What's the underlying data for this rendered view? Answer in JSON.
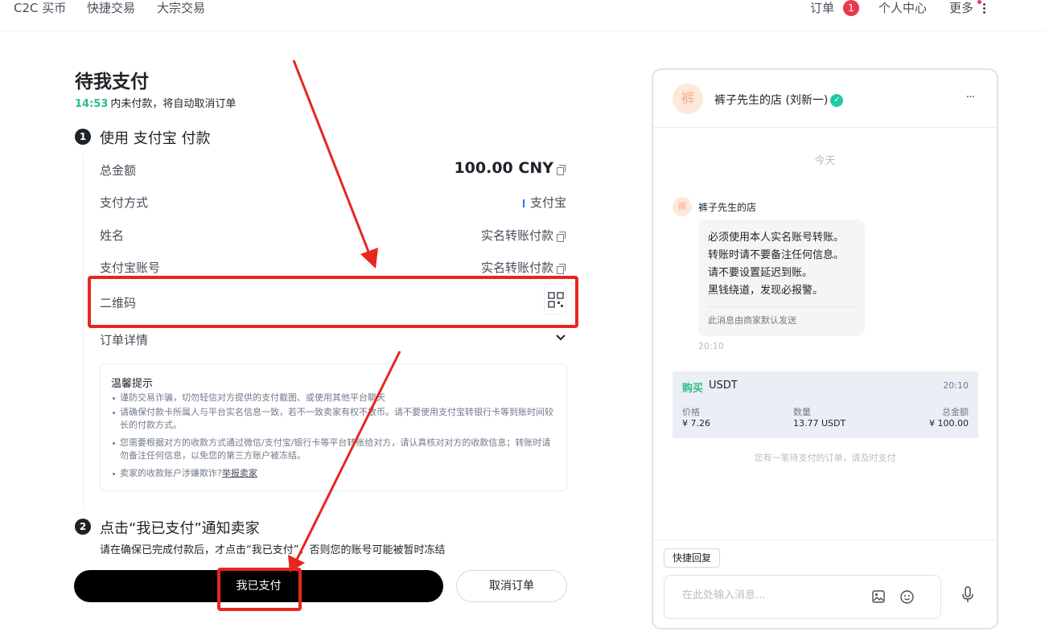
{
  "nav": {
    "c2c_buy": "C2C 买币",
    "quick_trade": "快捷交易",
    "bulk_trade": "大宗交易",
    "orders": "订单",
    "orders_badge": "1",
    "profile": "个人中心",
    "more": "更多"
  },
  "page": {
    "title": "待我支付",
    "countdown_time": "14:53",
    "countdown_text": "内未付款，将自动取消订单"
  },
  "step1": {
    "number": "1",
    "title": "使用 支付宝 付款",
    "rows": [
      {
        "label": "总金额",
        "value": "100.00 CNY"
      },
      {
        "label": "支付方式",
        "value": "支付宝"
      },
      {
        "label": "姓名",
        "value": "实名转账付款"
      },
      {
        "label": "支付宝账号",
        "value": "实名转账付款"
      },
      {
        "label": "二维码"
      },
      {
        "label": "订单详情"
      }
    ]
  },
  "tips": {
    "title": "温馨提示",
    "items": [
      "谨防交易诈骗，切勿轻信对方提供的支付截图、或使用其他平台聊天",
      "请确保付款卡所属人与平台实名信息一致，若不一致卖家有权不放币。请不要使用支付宝转银行卡等到账时间较长的付款方式。",
      "您需要根据对方的收款方式通过微信/支付宝/银行卡等平台转账给对方，请认真核对对方的收款信息；转账时请勿备注任何信息，以免您的第三方账户被冻结。",
      "卖家的收款账户涉嫌欺诈?"
    ],
    "report_link": "举报卖家"
  },
  "step2": {
    "number": "2",
    "title": "点击“我已支付”通知卖家",
    "desc": "请在确保已完成付款后，才点击“我已支付”，否则您的账号可能被暂时冻结"
  },
  "buttons": {
    "paid": "我已支付",
    "cancel": "取消订单"
  },
  "chat": {
    "avatar_char": "裤",
    "shop_name": "裤子先生的店 (刘新一)",
    "menu": "···",
    "date_label": "今天",
    "sender": "裤子先生的店",
    "message_lines": [
      "必须使用本人实名账号转账。",
      "转账时请不要备注任何信息。",
      "请不要设置延迟到账。",
      "黑钱绕道，发现必报警。"
    ],
    "auto_note": "此消息由商家默认发送",
    "message_time": "20:10",
    "order_card": {
      "side": "购买",
      "coin": "USDT",
      "time": "20:10",
      "price_label": "价格",
      "price": "¥ 7.26",
      "qty_label": "数量",
      "qty": "13.77 USDT",
      "total_label": "总金额",
      "total": "¥ 100.00"
    },
    "pending_hint": "您有一笔待支付的订单，请及时支付",
    "quick_reply": "快捷回复",
    "input_placeholder": "在此处输入消息..."
  },
  "colors": {
    "accent_green": "#2ebd85",
    "badge_red": "#e8394d",
    "annotation_red": "#e8261e",
    "alipay_blue": "#1677ff"
  }
}
